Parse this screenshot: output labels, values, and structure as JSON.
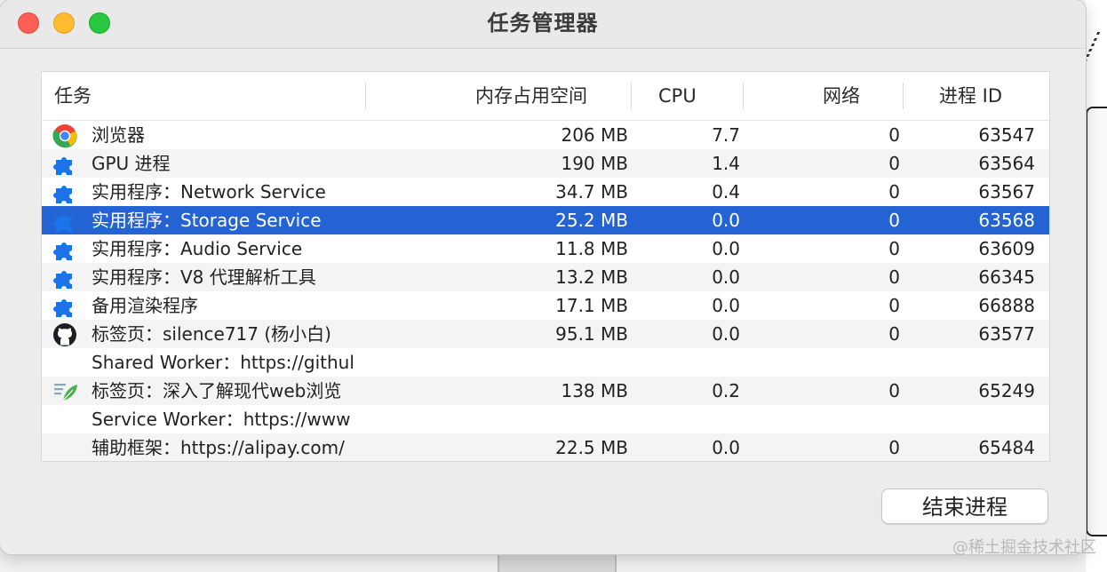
{
  "window": {
    "title": "任务管理器"
  },
  "table": {
    "columns": [
      "任务",
      "内存占用空间",
      "CPU",
      "网络",
      "进程 ID"
    ],
    "rows": [
      {
        "icon": "chrome-icon",
        "task": "浏览器",
        "memory": "206 MB",
        "cpu": "7.7",
        "network": "0",
        "pid": "63547"
      },
      {
        "icon": "puzzle-icon",
        "task": "GPU 进程",
        "memory": "190 MB",
        "cpu": "1.4",
        "network": "0",
        "pid": "63564"
      },
      {
        "icon": "puzzle-icon",
        "task": "实用程序：Network Service",
        "memory": "34.7 MB",
        "cpu": "0.4",
        "network": "0",
        "pid": "63567"
      },
      {
        "icon": "puzzle-icon",
        "task": "实用程序：Storage Service",
        "memory": "25.2 MB",
        "cpu": "0.0",
        "network": "0",
        "pid": "63568",
        "selected": true
      },
      {
        "icon": "puzzle-icon",
        "task": "实用程序：Audio Service",
        "memory": "11.8 MB",
        "cpu": "0.0",
        "network": "0",
        "pid": "63609"
      },
      {
        "icon": "puzzle-icon",
        "task": "实用程序：V8 代理解析工具",
        "memory": "13.2 MB",
        "cpu": "0.0",
        "network": "0",
        "pid": "66345"
      },
      {
        "icon": "puzzle-icon",
        "task": "备用渲染程序",
        "memory": "17.1 MB",
        "cpu": "0.0",
        "network": "0",
        "pid": "66888"
      },
      {
        "icon": "github-icon",
        "task": "标签页：silence717 (杨小白)",
        "memory": "95.1 MB",
        "cpu": "0.0",
        "network": "0",
        "pid": "63577"
      },
      {
        "icon": "",
        "task": "Shared Worker：https://githul",
        "memory": "",
        "cpu": "",
        "network": "",
        "pid": ""
      },
      {
        "icon": "leaf-document-icon",
        "task": "标签页：深入了解现代web浏览",
        "memory": "138 MB",
        "cpu": "0.2",
        "network": "0",
        "pid": "65249"
      },
      {
        "icon": "",
        "task": "Service Worker：https://www",
        "memory": "",
        "cpu": "",
        "network": "",
        "pid": ""
      },
      {
        "icon": "",
        "task": "辅助框架：https://alipay.com/",
        "memory": "22.5 MB",
        "cpu": "0.0",
        "network": "0",
        "pid": "65484"
      }
    ]
  },
  "footer": {
    "end_process_label": "结束进程"
  },
  "watermark": "@稀土掘金技术社区",
  "colors": {
    "selection": "#2463d4",
    "close": "#fe5f57",
    "minimize": "#febc2e",
    "maximize": "#28c840"
  }
}
